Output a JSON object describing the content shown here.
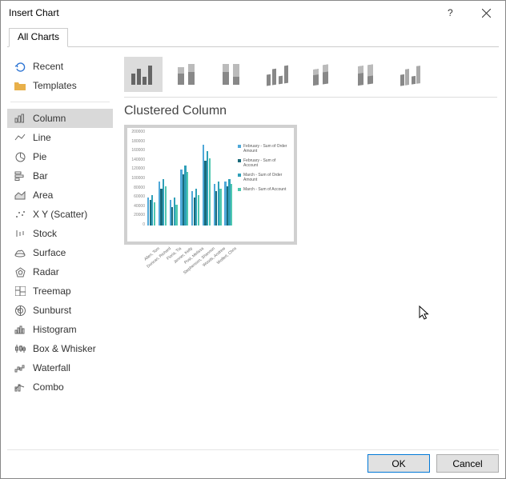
{
  "window": {
    "title": "Insert Chart"
  },
  "tabs": {
    "active": "All Charts"
  },
  "sidebar": {
    "recent": "Recent",
    "templates": "Templates",
    "types": [
      "Column",
      "Line",
      "Pie",
      "Bar",
      "Area",
      "X Y (Scatter)",
      "Stock",
      "Surface",
      "Radar",
      "Treemap",
      "Sunburst",
      "Histogram",
      "Box & Whisker",
      "Waterfall",
      "Combo"
    ],
    "selected_index": 0
  },
  "subtypes": {
    "selected_index": 0
  },
  "chart_name": "Clustered Column",
  "chart_data": {
    "type": "bar",
    "ylim": [
      0,
      200000
    ],
    "yticks": [
      "0",
      "20000",
      "40000",
      "60000",
      "80000",
      "100000",
      "120000",
      "140000",
      "160000",
      "180000",
      "200000"
    ],
    "categories": [
      "Allen, Tom",
      "Duncan, Richard",
      "Floria, Tia",
      "Jenner, Kelly",
      "Post, Melissa",
      "Stephenson, Shannon",
      "Woods, Andrew",
      "Wolfert, Chris"
    ],
    "series": [
      {
        "name": "February - Sum of Order Amount",
        "color": "#4fa8d8",
        "values": [
          60000,
          95000,
          55000,
          120000,
          75000,
          175000,
          90000,
          95000
        ]
      },
      {
        "name": "February - Sum of Account",
        "color": "#1a6a7a",
        "values": [
          55000,
          80000,
          40000,
          110000,
          60000,
          140000,
          75000,
          85000
        ]
      },
      {
        "name": "March - Sum of Order Amount",
        "color": "#2f9fb8",
        "values": [
          65000,
          100000,
          60000,
          130000,
          80000,
          160000,
          95000,
          100000
        ]
      },
      {
        "name": "March - Sum of Account",
        "color": "#4fc7b0",
        "values": [
          50000,
          85000,
          45000,
          115000,
          65000,
          145000,
          80000,
          90000
        ]
      }
    ]
  },
  "buttons": {
    "ok": "OK",
    "cancel": "Cancel"
  }
}
